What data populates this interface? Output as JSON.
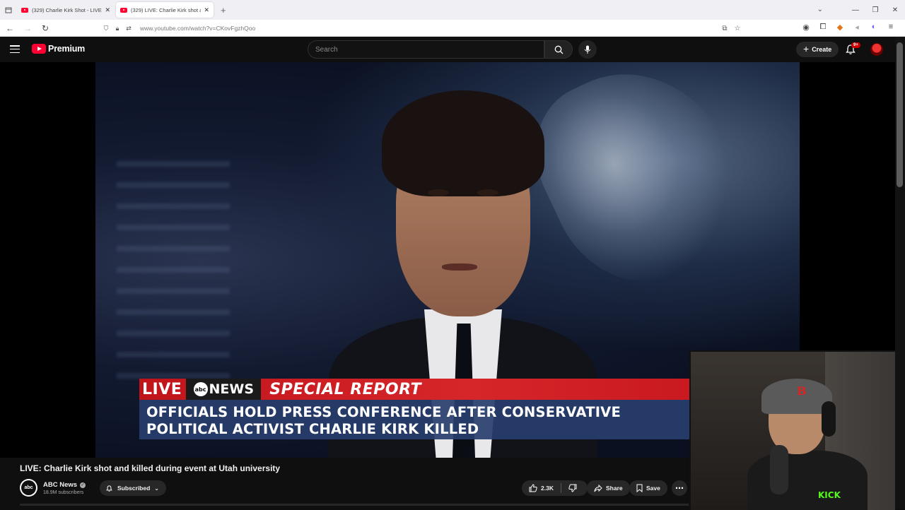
{
  "browser": {
    "tabs": [
      {
        "title": "(329) Charlie Kirk Shot - LIVE Br",
        "active": false
      },
      {
        "title": "(329) LIVE: Charlie Kirk shot and",
        "active": true
      }
    ],
    "url": "www.youtube.com/watch?v=CKovFgzhQoo"
  },
  "youtube": {
    "brand": "Premium",
    "search_placeholder": "Search",
    "create_label": "Create",
    "notification_badge": "9+"
  },
  "video": {
    "lower_third": {
      "live": "LIVE",
      "network": "NEWS",
      "network_logo": "abc",
      "banner": "SPECIAL REPORT",
      "headline_line1": "OFFICIALS HOLD PRESS CONFERENCE AFTER CONSERVATIVE",
      "headline_line2": "POLITICAL ACTIVIST CHARLIE KIRK KILLED"
    },
    "webcam_overlay": {
      "cap_letter": "B",
      "shirt_text": "KICK"
    },
    "title": "LIVE: Charlie Kirk shot and killed during event at Utah university"
  },
  "channel": {
    "avatar_text": "abc",
    "name": "ABC News",
    "subscribers": "18.9M subscribers",
    "subscribe_label": "Subscribed"
  },
  "actions": {
    "likes": "2.3K",
    "share": "Share",
    "save": "Save"
  }
}
